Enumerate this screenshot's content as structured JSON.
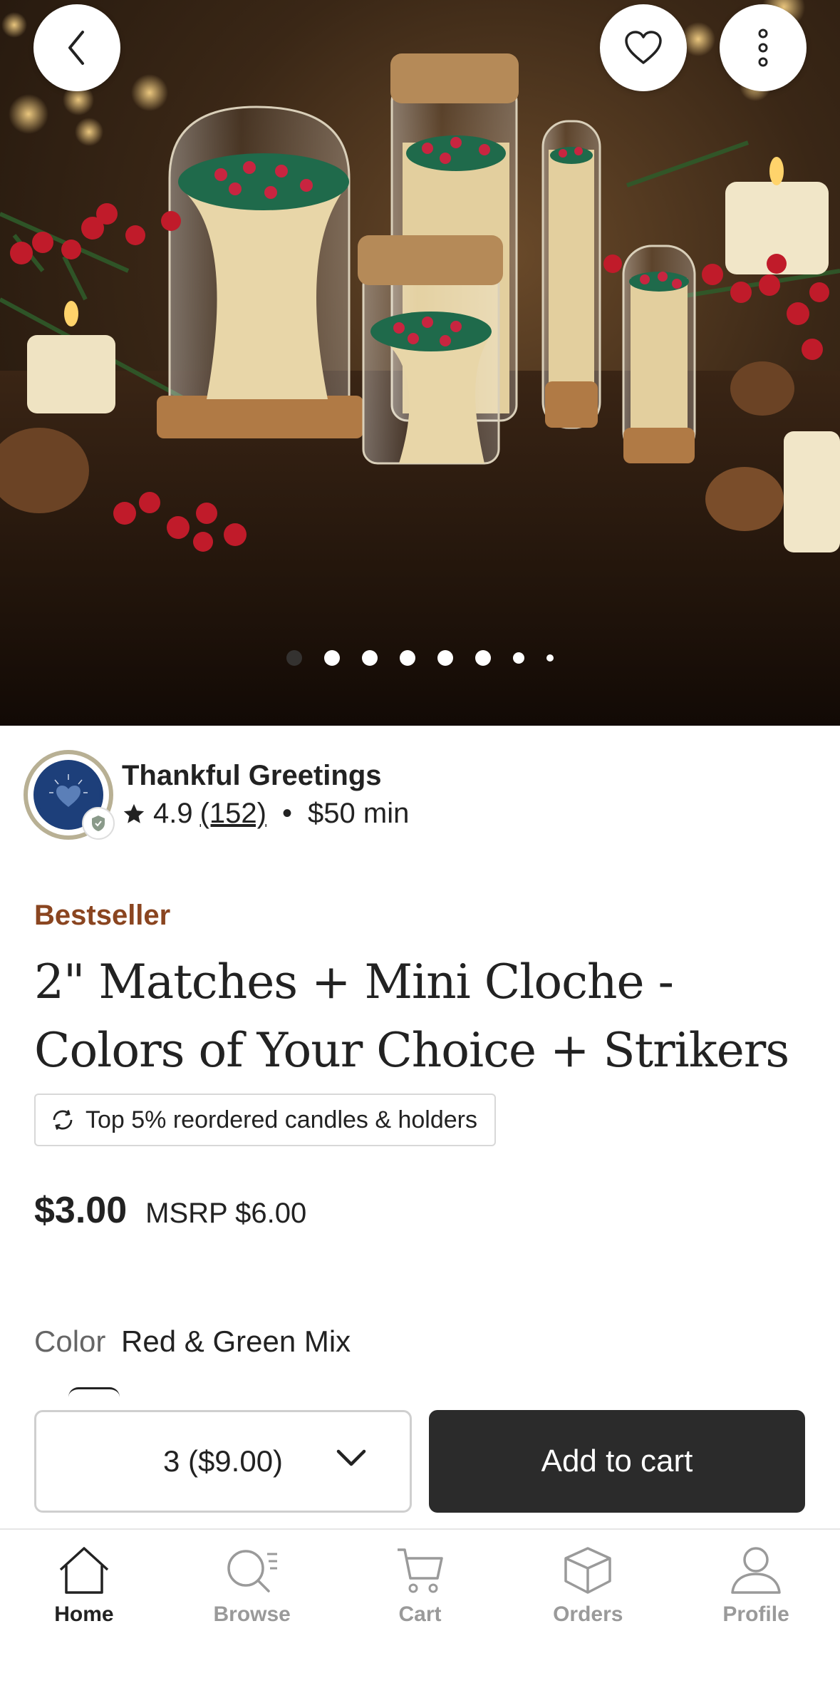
{
  "hero": {
    "image_alt": "Glass cloches and cork-topped jars filled with red and green tipped matches on a dark wood table with candles, pine and holly berries",
    "carousel": {
      "count": 8,
      "active_index": 0
    }
  },
  "shop": {
    "name": "Thankful Greetings",
    "logo_text": "THANKFUL GREETINGS",
    "rating": "4.9",
    "reviews": "(152)",
    "separator": "•",
    "minimum": "$50 min"
  },
  "product": {
    "badge": "Bestseller",
    "title": "2\" Matches + Mini Cloche - Colors of Your Choice + Strikers",
    "reorder_tag": "Top 5% reordered candles & holders",
    "price": "$3.00",
    "msrp": "MSRP $6.00",
    "color_label": "Color",
    "color_value": "Red & Green Mix"
  },
  "actions": {
    "quantity_value": "3 ($9.00)",
    "add_to_cart_label": "Add to cart"
  },
  "tabs": [
    {
      "label": "Home",
      "icon": "home-icon",
      "active": true
    },
    {
      "label": "Browse",
      "icon": "browse-icon",
      "active": false
    },
    {
      "label": "Cart",
      "icon": "cart-icon",
      "active": false
    },
    {
      "label": "Orders",
      "icon": "orders-icon",
      "active": false
    },
    {
      "label": "Profile",
      "icon": "profile-icon",
      "active": false
    }
  ],
  "colors": {
    "accent_badge": "#8a4520",
    "button_dark": "#2b2b2b",
    "logo_navy": "#1d3f7a"
  }
}
